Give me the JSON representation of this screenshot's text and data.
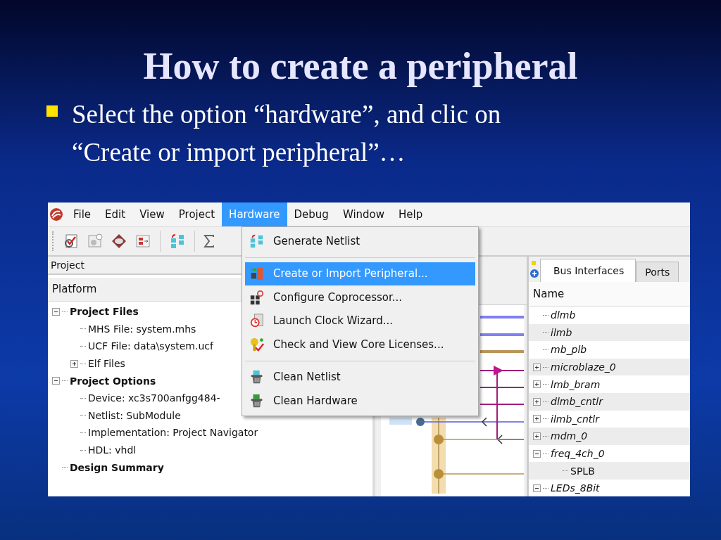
{
  "slide": {
    "title": "How to create a peripheral",
    "bullets": [
      "Select the option “hardware”, and clic on “Create or import peripheral”…"
    ]
  },
  "window": {
    "menubar": [
      {
        "label": "File",
        "selected": false
      },
      {
        "label": "Edit",
        "selected": false
      },
      {
        "label": "View",
        "selected": false
      },
      {
        "label": "Project",
        "selected": false
      },
      {
        "label": "Hardware",
        "selected": true
      },
      {
        "label": "Debug",
        "selected": false
      },
      {
        "label": "Window",
        "selected": false
      },
      {
        "label": "Help",
        "selected": false
      }
    ],
    "project_panel": {
      "title": "Project",
      "tab": "Platform",
      "tree": [
        {
          "label": "Project Files",
          "expanded": true,
          "children": [
            {
              "label": "MHS File: system.mhs"
            },
            {
              "label": "UCF File: data\\system.ucf"
            },
            {
              "label": "Elf Files",
              "expanded": false
            }
          ]
        },
        {
          "label": "Project Options",
          "expanded": true,
          "children": [
            {
              "label": "Device: xc3s700anfgg484-"
            },
            {
              "label": "Netlist: SubModule"
            },
            {
              "label": "Implementation: Project Navigator"
            },
            {
              "label": "HDL: vhdl"
            }
          ]
        },
        {
          "label": "Design Summary"
        }
      ]
    },
    "menu": {
      "groups": [
        [
          {
            "label": "Generate Netlist",
            "selected": false
          }
        ],
        [
          {
            "label": "Create or Import Peripheral...",
            "selected": true
          },
          {
            "label": "Configure Coprocessor...",
            "selected": false
          },
          {
            "label": "Launch Clock Wizard...",
            "selected": false
          },
          {
            "label": "Check and View Core Licenses...",
            "selected": false
          }
        ],
        [
          {
            "label": "Clean Netlist",
            "selected": false
          },
          {
            "label": "Clean Hardware",
            "selected": false
          }
        ]
      ]
    },
    "bus_panel": {
      "tabs": [
        {
          "label": "Bus Interfaces",
          "selected": true
        },
        {
          "label": "Ports",
          "selected": false
        }
      ],
      "column": "Name",
      "tree": [
        {
          "label": "dlmb"
        },
        {
          "label": "ilmb"
        },
        {
          "label": "mb_plb"
        },
        {
          "label": "microblaze_0",
          "expanded": false
        },
        {
          "label": "lmb_bram",
          "expanded": false
        },
        {
          "label": "dlmb_cntlr",
          "expanded": false
        },
        {
          "label": "ilmb_cntlr",
          "expanded": false
        },
        {
          "label": "mdm_0",
          "expanded": false
        },
        {
          "label": "freq_4ch_0",
          "expanded": true,
          "children": [
            {
              "label": "SPLB"
            }
          ]
        },
        {
          "label": "LEDs_8Bit",
          "expanded": true
        }
      ]
    }
  }
}
